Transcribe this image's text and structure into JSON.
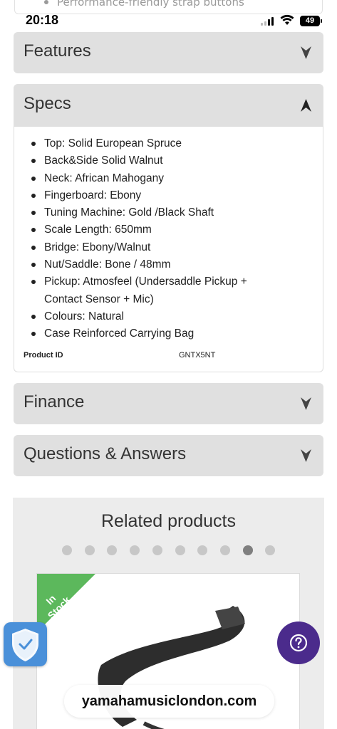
{
  "status_bar": {
    "time": "20:18",
    "battery": "49"
  },
  "previous_section": {
    "last_item": "Performance-friendly strap buttons"
  },
  "accordions": {
    "features": {
      "title": "Features"
    },
    "specs": {
      "title": "Specs",
      "items": [
        "Top: Solid European Spruce",
        "Back&Side Solid Walnut",
        "Neck: African Mahogany",
        "Fingerboard: Ebony",
        "Tuning Machine: Gold /Black Shaft",
        "Scale Length: 650mm",
        "Bridge: Ebony/Walnut",
        "Nut/Saddle: Bone / 48mm",
        "Pickup: Atmosfeel (Undersaddle Pickup +",
        "Contact Sensor + Mic)",
        "Colours: Natural",
        "Case Reinforced Carrying Bag"
      ],
      "product_id_label": "Product ID",
      "product_id_value": "GNTX5NT"
    },
    "finance": {
      "title": "Finance"
    },
    "qa": {
      "title": "Questions & Answers"
    }
  },
  "related": {
    "title": "Related products",
    "slide_count": 10,
    "active_slide": 9,
    "card": {
      "badge": "In Stock"
    }
  },
  "browser": {
    "url": "yamahamusiclondon.com"
  },
  "colors": {
    "accordion_bg": "#e0e0e0",
    "badge_green": "#5cb85c",
    "help_purple": "#4b2b8c",
    "shield_blue": "#4a90d9"
  }
}
